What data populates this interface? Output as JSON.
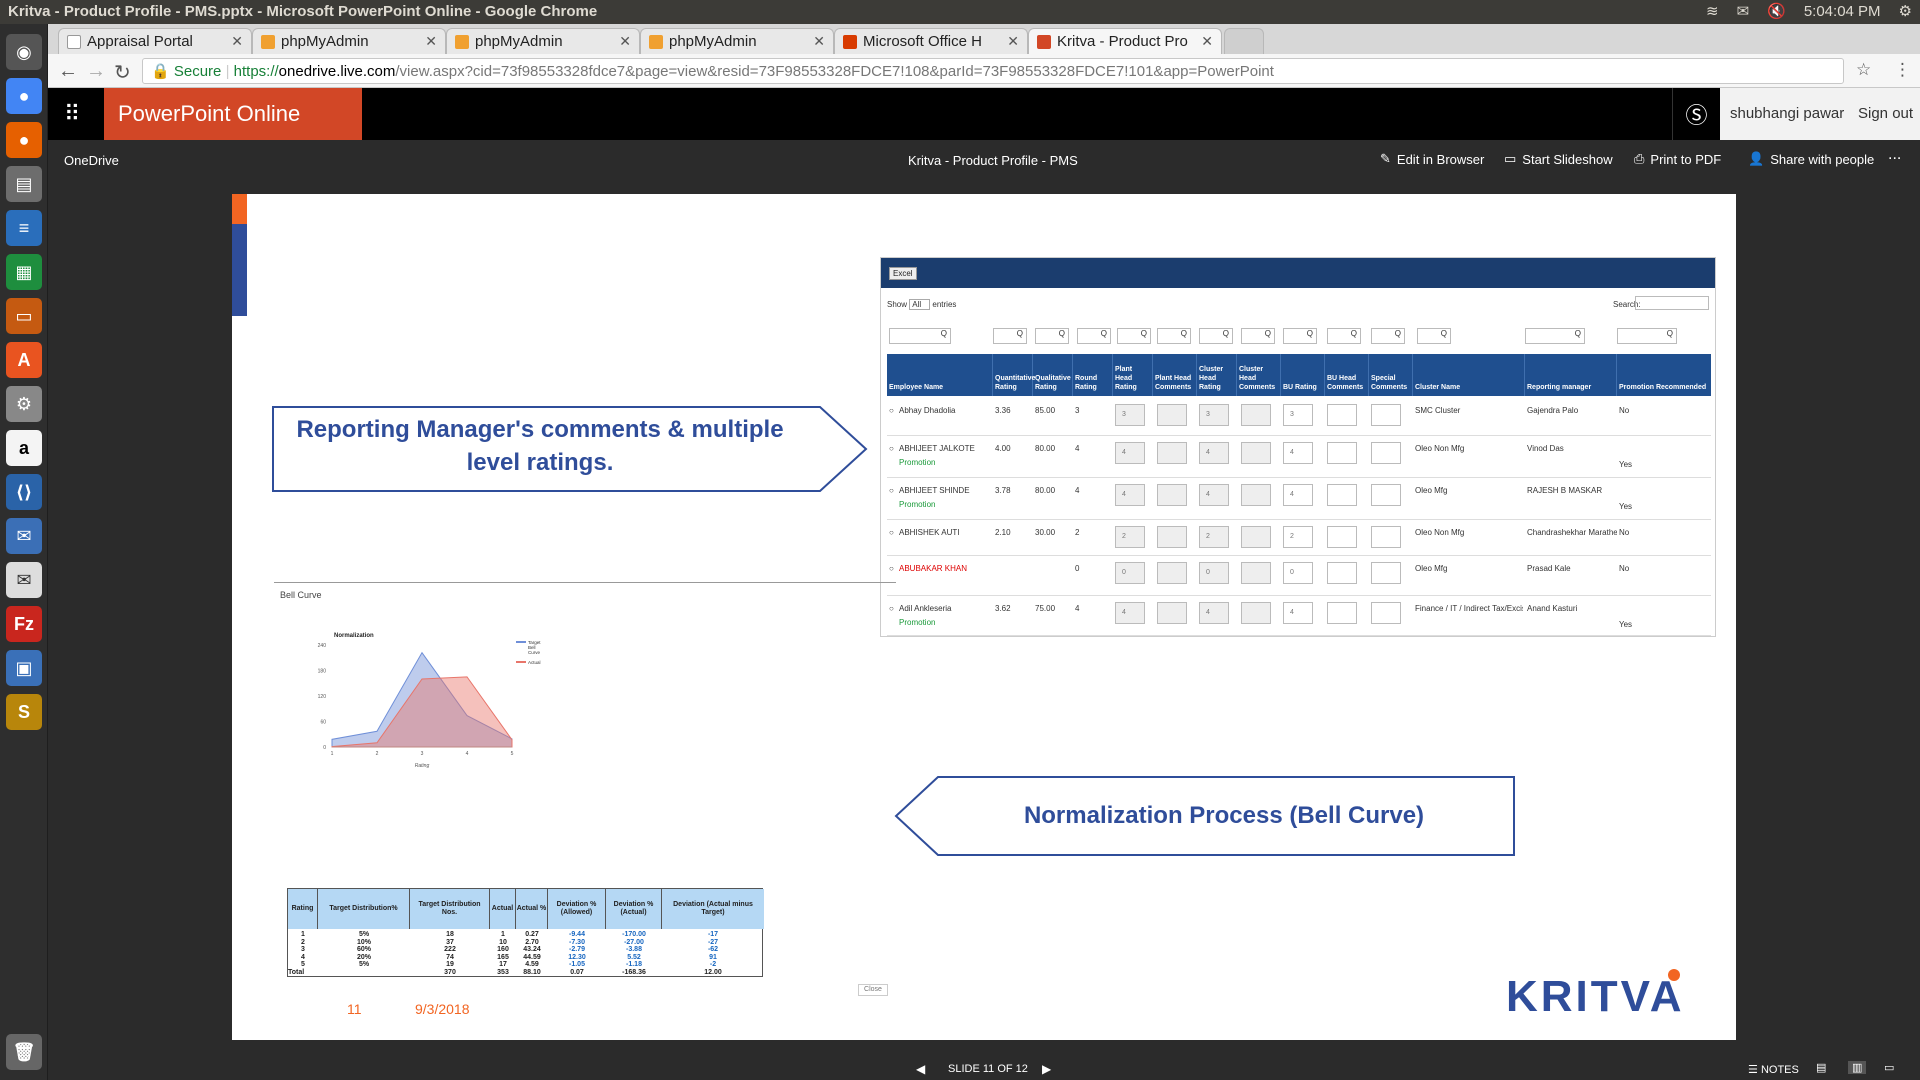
{
  "os_bar": {
    "window_title": "Kritva - Product Profile - PMS.pptx - Microsoft PowerPoint Online - Google Chrome",
    "time": "5:04:04 PM"
  },
  "tabs": [
    {
      "label": "Appraisal Portal"
    },
    {
      "label": "phpMyAdmin"
    },
    {
      "label": "phpMyAdmin"
    },
    {
      "label": "phpMyAdmin"
    },
    {
      "label": "Microsoft Office H"
    },
    {
      "label": "Kritva - Product Pro"
    }
  ],
  "address": {
    "secure_label": "Secure",
    "url_scheme": "https://",
    "url_host": "onedrive.live.com",
    "url_path": "/view.aspx?cid=73f98553328fdce7&page=view&resid=73F98553328FDCE7!108&parId=73F98553328FDCE7!101&app=PowerPoint"
  },
  "ppt_header": {
    "app_name": "PowerPoint Online",
    "user_name": "shubhangi pawar",
    "sign_out": "Sign out"
  },
  "ppt_toolbar": {
    "onedrive": "OneDrive",
    "doc_title": "Kritva - Product Profile - PMS",
    "edit": "Edit in Browser",
    "slideshow": "Start Slideshow",
    "print": "Print to PDF",
    "share": "Share with people",
    "more": "..."
  },
  "slide": {
    "callout_top": "Reporting Manager's comments & multiple level ratings.",
    "callout_bottom": "Normalization Process (Bell Curve)",
    "slide_number": "11",
    "date": "9/3/2018",
    "logo_text": "KRITVA",
    "accent_orange": "#f26522",
    "accent_blue": "#2f4d9a"
  },
  "embedded_table": {
    "excel_btn": "Excel",
    "show_label": "Show",
    "show_value": "All",
    "entries_label": "entries",
    "search_label": "Search:",
    "headers": [
      "Employee Name",
      "Quantitative Rating",
      "Qualitative Rating",
      "Round Rating",
      "Plant Head Rating",
      "Plant Head Comments",
      "Cluster Head Rating",
      "Cluster Head Comments",
      "BU Rating",
      "BU Head Comments",
      "Special Comments",
      "Cluster Name",
      "Reporting manager",
      "Promotion Recommended"
    ],
    "rows": [
      {
        "name": "Abhay Dhadolia",
        "sub": "",
        "quant": "3.36",
        "qual": "85.00",
        "round": "3",
        "ph": "3",
        "ch": "3",
        "bu": "3",
        "cluster": "SMC Cluster",
        "manager": "Gajendra Palo",
        "promo": "No"
      },
      {
        "name": "ABHIJEET JALKOTE",
        "sub": "Promotion",
        "quant": "4.00",
        "qual": "80.00",
        "round": "4",
        "ph": "4",
        "ch": "4",
        "bu": "4",
        "cluster": "Oleo Non Mfg",
        "manager": "Vinod Das",
        "promo": "Yes"
      },
      {
        "name": "ABHIJEET SHINDE",
        "sub": "Promotion",
        "quant": "3.78",
        "qual": "80.00",
        "round": "4",
        "ph": "4",
        "ch": "4",
        "bu": "4",
        "cluster": "Oleo Mfg",
        "manager": "RAJESH B MASKAR",
        "promo": "Yes"
      },
      {
        "name": "ABHISHEK AUTI",
        "sub": "",
        "quant": "2.10",
        "qual": "30.00",
        "round": "2",
        "ph": "2",
        "ch": "2",
        "bu": "2",
        "cluster": "Oleo Non Mfg",
        "manager": "Chandrashekhar Marathe",
        "promo": "No"
      },
      {
        "name": "ABUBAKAR KHAN",
        "sub": "",
        "quant": "",
        "qual": "",
        "round": "0",
        "ph": "0",
        "ch": "0",
        "bu": "0",
        "cluster": "Oleo Mfg",
        "manager": "Prasad Kale",
        "promo": "No"
      },
      {
        "name": "Adil Ankleseria",
        "sub": "Promotion",
        "quant": "3.62",
        "qual": "75.00",
        "round": "4",
        "ph": "4",
        "ch": "4",
        "bu": "4",
        "cluster": "Finance / IT / Indirect Tax/Excise/EXIM",
        "manager": "Anand Kasturi",
        "promo": "Yes"
      }
    ]
  },
  "bell_curve": {
    "section_title": "Bell Curve",
    "chart_title": "Normalization",
    "xlabel": "Rating",
    "legend": [
      "Target Bell Curve",
      "Actual"
    ],
    "target_color": "#6f8fd8",
    "actual_color": "#e8756a",
    "y_ticks": [
      "240",
      "180",
      "120",
      "60",
      "0"
    ],
    "x_ticks": [
      "1",
      "2",
      "3",
      "4",
      "5"
    ],
    "target": [
      18,
      37,
      222,
      74,
      19
    ],
    "actual": [
      1,
      10,
      160,
      165,
      17
    ],
    "ylim": [
      0,
      240
    ],
    "close": "Close"
  },
  "norm_table": {
    "headers": [
      "Rating",
      "Target Distribution%",
      "Target Distribution Nos.",
      "Actual",
      "Actual %",
      "Deviation % (Allowed)",
      "Deviation % (Actual)",
      "Deviation (Actual minus Target)"
    ],
    "rows": [
      [
        "1",
        "5%",
        "18",
        "1",
        "0.27",
        "-9.44",
        "-170.00",
        "-17"
      ],
      [
        "2",
        "10%",
        "37",
        "10",
        "2.70",
        "-7.30",
        "-27.00",
        "-27"
      ],
      [
        "3",
        "60%",
        "222",
        "160",
        "43.24",
        "-2.79",
        "-3.88",
        "-62"
      ],
      [
        "4",
        "20%",
        "74",
        "165",
        "44.59",
        "12.30",
        "5.52",
        "91"
      ],
      [
        "5",
        "5%",
        "19",
        "17",
        "4.59",
        "-1.05",
        "-1.18",
        "-2"
      ],
      [
        "Total",
        "",
        "370",
        "353",
        "88.10",
        "0.07",
        "-168.36",
        "12.00"
      ]
    ]
  },
  "status_bar": {
    "slide_of": "SLIDE 11 OF 12",
    "notes": "NOTES"
  }
}
